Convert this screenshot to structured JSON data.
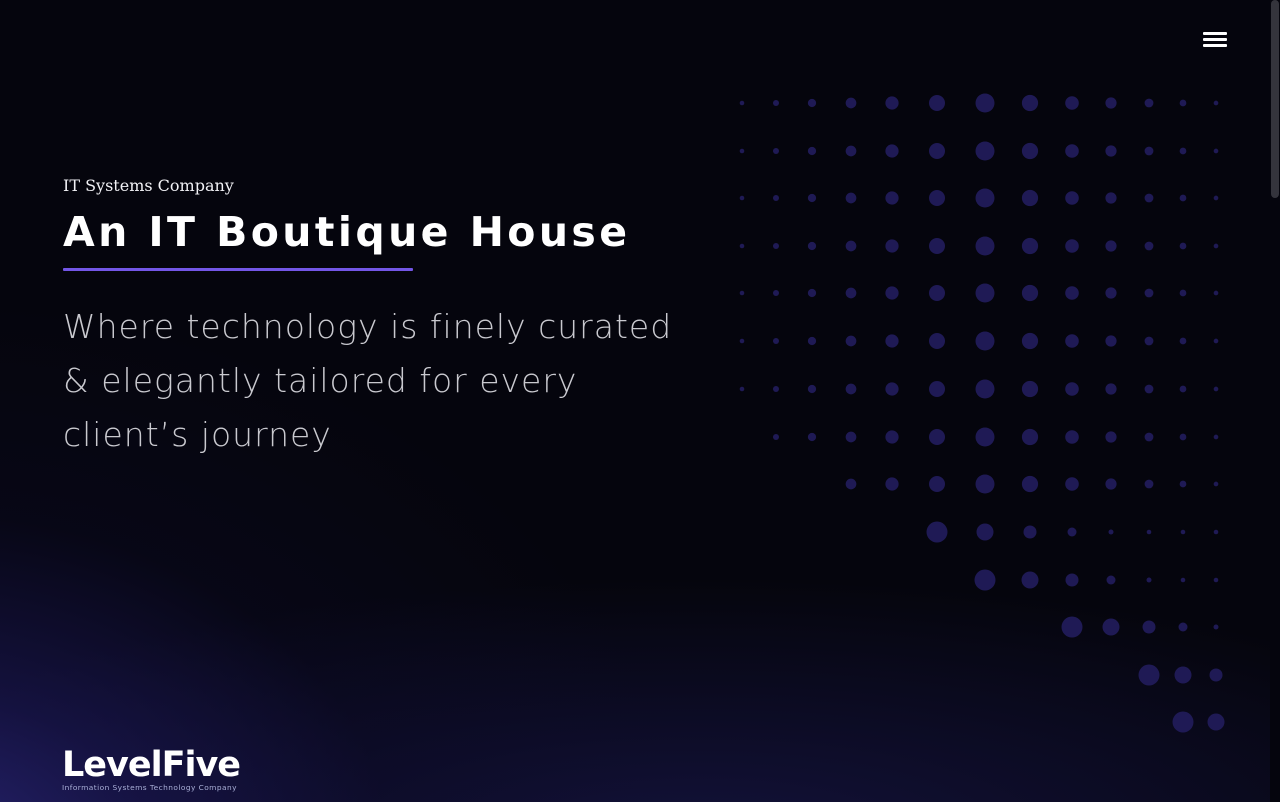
{
  "header": {
    "menu_icon": "hamburger-menu-icon"
  },
  "hero": {
    "eyebrow": "IT Systems Company",
    "title": "An IT Boutique House",
    "tagline": "Where technology is finely curated & elegantly tailored for every client’s journey"
  },
  "logo": {
    "wordmark": "LevelFive",
    "subtitle": "Information Systems Technology Company"
  },
  "colors": {
    "background": "#05050d",
    "accent": "#7356e6",
    "dot": "#1f1a55",
    "glow": "#2a2678",
    "text": "#ffffff",
    "muted_text": "#c9c9cf"
  }
}
